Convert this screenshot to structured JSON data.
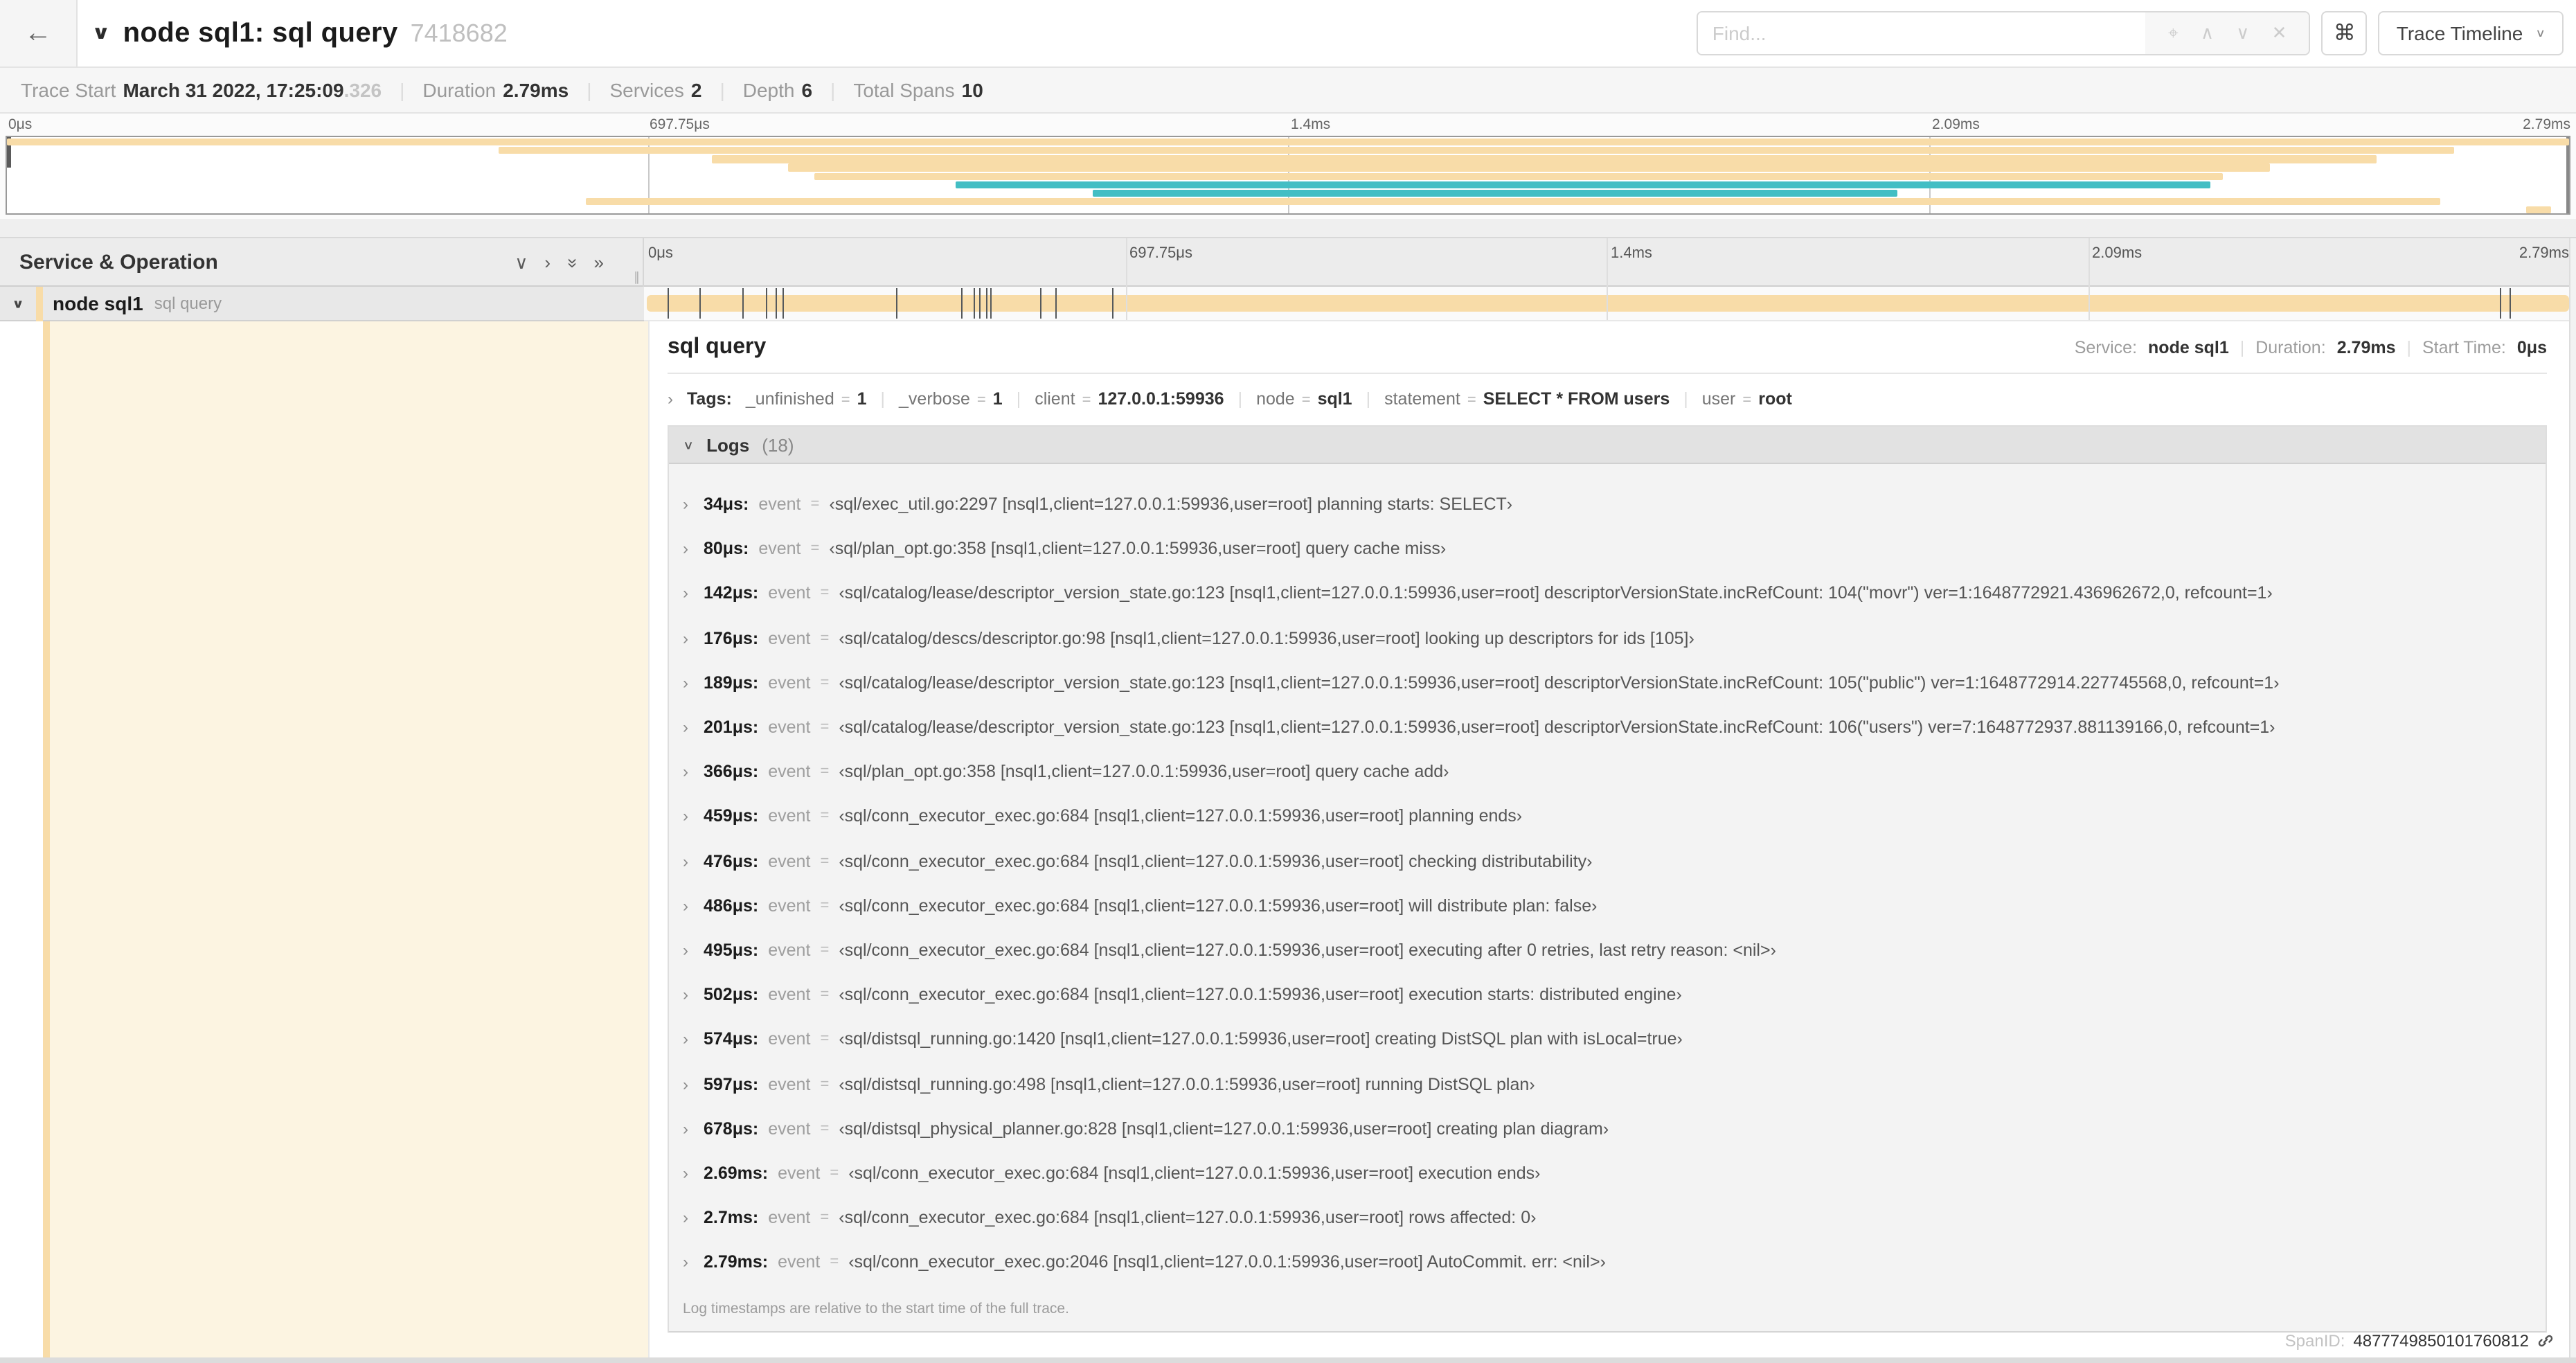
{
  "colors": {
    "tan": "#F8DCA8",
    "teal": "#43BEC4",
    "cream": "#FCF4E1"
  },
  "header": {
    "back_arrow": "←",
    "collapse_chevron": "∨",
    "title": "node sql1: sql query",
    "trace_id": "7418682",
    "find_placeholder": "Find...",
    "find_icons": [
      "⌖",
      "∧",
      "∨",
      "✕"
    ],
    "shortcut_key": "⌘",
    "view_dropdown_label": "Trace Timeline"
  },
  "trace_meta": {
    "items": [
      {
        "label": "Trace Start",
        "value": "March 31 2022, 17:25:09",
        "frac": ".326"
      },
      {
        "label": "Duration",
        "value": "2.79ms"
      },
      {
        "label": "Services",
        "value": "2"
      },
      {
        "label": "Depth",
        "value": "6"
      },
      {
        "label": "Total Spans",
        "value": "10"
      }
    ]
  },
  "timeline": {
    "tick_labels": [
      "0μs",
      "697.75μs",
      "1.4ms",
      "2.09ms",
      "2.79ms"
    ],
    "grid_pct": [
      25,
      50,
      75
    ],
    "minimap_rows": [
      {
        "s": 0,
        "w": 100,
        "c": "tan"
      },
      {
        "s": 19.2,
        "w": 76.3,
        "c": "tan"
      },
      {
        "s": 27.5,
        "w": 65.0,
        "c": "tan"
      },
      {
        "s": 30.5,
        "w": 57.8,
        "c": "tan"
      },
      {
        "s": 31.5,
        "w": 55.0,
        "c": "tan"
      },
      {
        "s": 37.0,
        "w": 49.0,
        "c": "teal"
      },
      {
        "s": 42.4,
        "w": 31.4,
        "c": "teal"
      },
      {
        "s": 22.6,
        "w": 72.4,
        "c": "tan"
      },
      {
        "s": 98.3,
        "w": 1.0,
        "c": "tan"
      }
    ]
  },
  "table": {
    "left_header": "Service & Operation",
    "header_icons": [
      "∨",
      "›",
      "»",
      "»"
    ],
    "grip": "∥",
    "row": {
      "chevron": "∨",
      "service": "node sql1",
      "operation": "sql query"
    },
    "span_ticks_pct": [
      1.2,
      2.9,
      5.1,
      6.3,
      6.8,
      7.2,
      13.1,
      16.5,
      17.1,
      17.4,
      17.8,
      18.0,
      20.6,
      21.4,
      24.3,
      96.4,
      96.9
    ]
  },
  "detail": {
    "title": "sql query",
    "service_label": "Service:",
    "service": "node sql1",
    "duration_label": "Duration:",
    "duration": "2.79ms",
    "start_label": "Start Time:",
    "start": "0μs",
    "sep": "|",
    "chevron_collapsed": "›",
    "chevron_expanded": "∨",
    "tags_label": "Tags:",
    "eq": "=",
    "tags": [
      {
        "key": "_unfinished",
        "value": "1"
      },
      {
        "key": "_verbose",
        "value": "1"
      },
      {
        "key": "client",
        "value": "127.0.0.1:59936"
      },
      {
        "key": "node",
        "value": "sql1"
      },
      {
        "key": "statement",
        "value": "SELECT * FROM users"
      },
      {
        "key": "user",
        "value": "root"
      }
    ],
    "logs_label": "Logs",
    "logs_count": "(18)",
    "event_key": "event",
    "logs": [
      {
        "time": "34μs:",
        "value": "‹sql/exec_util.go:2297 [nsql1,client=127.0.0.1:59936,user=root] planning starts: SELECT›"
      },
      {
        "time": "80μs:",
        "value": "‹sql/plan_opt.go:358 [nsql1,client=127.0.0.1:59936,user=root] query cache miss›"
      },
      {
        "time": "142μs:",
        "value": "‹sql/catalog/lease/descriptor_version_state.go:123 [nsql1,client=127.0.0.1:59936,user=root] descriptorVersionState.incRefCount: 104(\"movr\") ver=1:1648772921.436962672,0, refcount=1›"
      },
      {
        "time": "176μs:",
        "value": "‹sql/catalog/descs/descriptor.go:98 [nsql1,client=127.0.0.1:59936,user=root] looking up descriptors for ids [105]›"
      },
      {
        "time": "189μs:",
        "value": "‹sql/catalog/lease/descriptor_version_state.go:123 [nsql1,client=127.0.0.1:59936,user=root] descriptorVersionState.incRefCount: 105(\"public\") ver=1:1648772914.227745568,0, refcount=1›"
      },
      {
        "time": "201μs:",
        "value": "‹sql/catalog/lease/descriptor_version_state.go:123 [nsql1,client=127.0.0.1:59936,user=root] descriptorVersionState.incRefCount: 106(\"users\") ver=7:1648772937.881139166,0, refcount=1›"
      },
      {
        "time": "366μs:",
        "value": "‹sql/plan_opt.go:358 [nsql1,client=127.0.0.1:59936,user=root] query cache add›"
      },
      {
        "time": "459μs:",
        "value": "‹sql/conn_executor_exec.go:684 [nsql1,client=127.0.0.1:59936,user=root] planning ends›"
      },
      {
        "time": "476μs:",
        "value": "‹sql/conn_executor_exec.go:684 [nsql1,client=127.0.0.1:59936,user=root] checking distributability›"
      },
      {
        "time": "486μs:",
        "value": "‹sql/conn_executor_exec.go:684 [nsql1,client=127.0.0.1:59936,user=root] will distribute plan: false›"
      },
      {
        "time": "495μs:",
        "value": "‹sql/conn_executor_exec.go:684 [nsql1,client=127.0.0.1:59936,user=root] executing after 0 retries, last retry reason: <nil>›"
      },
      {
        "time": "502μs:",
        "value": "‹sql/conn_executor_exec.go:684 [nsql1,client=127.0.0.1:59936,user=root] execution starts: distributed engine›"
      },
      {
        "time": "574μs:",
        "value": "‹sql/distsql_running.go:1420 [nsql1,client=127.0.0.1:59936,user=root] creating DistSQL plan with isLocal=true›"
      },
      {
        "time": "597μs:",
        "value": "‹sql/distsql_running.go:498 [nsql1,client=127.0.0.1:59936,user=root] running DistSQL plan›"
      },
      {
        "time": "678μs:",
        "value": "‹sql/distsql_physical_planner.go:828 [nsql1,client=127.0.0.1:59936,user=root] creating plan diagram›"
      },
      {
        "time": "2.69ms:",
        "value": "‹sql/conn_executor_exec.go:684 [nsql1,client=127.0.0.1:59936,user=root] execution ends›"
      },
      {
        "time": "2.7ms:",
        "value": "‹sql/conn_executor_exec.go:684 [nsql1,client=127.0.0.1:59936,user=root] rows affected: 0›"
      },
      {
        "time": "2.79ms:",
        "value": "‹sql/conn_executor_exec.go:2046 [nsql1,client=127.0.0.1:59936,user=root] AutoCommit. err: <nil>›"
      }
    ],
    "note": "Log timestamps are relative to the start time of the full trace.",
    "span_id_label": "SpanID:",
    "span_id": "4877749850101760812"
  }
}
